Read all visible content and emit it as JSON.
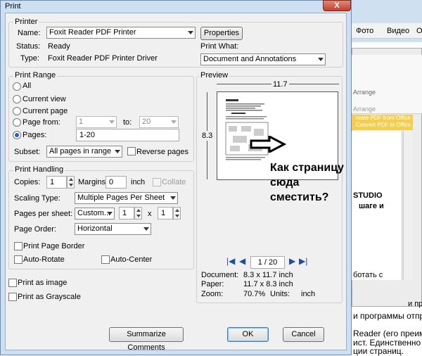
{
  "window": {
    "title": "Print",
    "close_label": "X"
  },
  "printer": {
    "group_label": "Printer",
    "name_label": "Name:",
    "name_value": "Foxit Reader PDF Printer",
    "properties_label": "Properties",
    "status_label": "Status:",
    "status_value": "Ready",
    "type_label": "Type:",
    "type_value": "Foxit Reader PDF Printer Driver",
    "print_what_label": "Print What:",
    "print_what_value": "Document and Annotations"
  },
  "print_range": {
    "group_label": "Print Range",
    "all_label": "All",
    "current_view_label": "Current view",
    "current_page_label": "Current page",
    "page_from_label": "Page from:",
    "page_from_value": "1",
    "to_label": "to:",
    "to_value": "20",
    "pages_label": "Pages:",
    "pages_value": "1-20",
    "subset_label": "Subset:",
    "subset_value": "All pages in range",
    "reverse_label": "Reverse pages"
  },
  "print_handling": {
    "group_label": "Print Handling",
    "copies_label": "Copies:",
    "copies_value": "1",
    "margins_label": "Margins:",
    "margins_value": "0",
    "margins_unit": "inch",
    "collate_label": "Collate",
    "scaling_label": "Scaling Type:",
    "scaling_value": "Multiple Pages Per Sheet",
    "pages_per_sheet_label": "Pages per sheet:",
    "pps_value": "Custom...",
    "pps_a": "1",
    "pps_x": "x",
    "pps_b": "1",
    "page_order_label": "Page Order:",
    "page_order_value": "Horizontal",
    "border_label": "Print Page Border",
    "autorotate_label": "Auto-Rotate",
    "autocenter_label": "Auto-Center"
  },
  "options": {
    "print_as_image_label": "Print as image",
    "print_as_grayscale_label": "Print as Grayscale"
  },
  "preview": {
    "group_label": "Preview",
    "width_dim": "11.7",
    "height_dim": "8.3",
    "page_indicator": "1 / 20",
    "document_label": "Document:",
    "document_value": "8.3 x 11.7 inch",
    "paper_label": "Paper:",
    "paper_value": "11.7 x 8.3 inch",
    "zoom_label": "Zoom:",
    "zoom_value": "70.7%",
    "units_label": "Units:",
    "units_value": "inch"
  },
  "buttons": {
    "summarize_label": "Summarize Comments",
    "ok_label": "OK",
    "cancel_label": "Cancel"
  },
  "annotation": {
    "line1": "Как страницу",
    "line2": "сюда",
    "line3": "сместить?"
  },
  "background": {
    "tab_photo": "Фото",
    "tab_video": "Видео",
    "tab_other": "О",
    "arrange": "Arrange",
    "arrange2": "Arrange",
    "promo_line1": "reate PDF from Office",
    "promo_line2": "Convert PDF to Office",
    "studio": "STUDIO",
    "shage": "шаге и",
    "botat": "ботать с",
    "ist": "ист.",
    "text1": "и программы отпра",
    "text2": "Reader (его преиму",
    "text3": "ист. Единственно пр",
    "text4": "ции страниц.",
    "text_r": "и пр"
  }
}
